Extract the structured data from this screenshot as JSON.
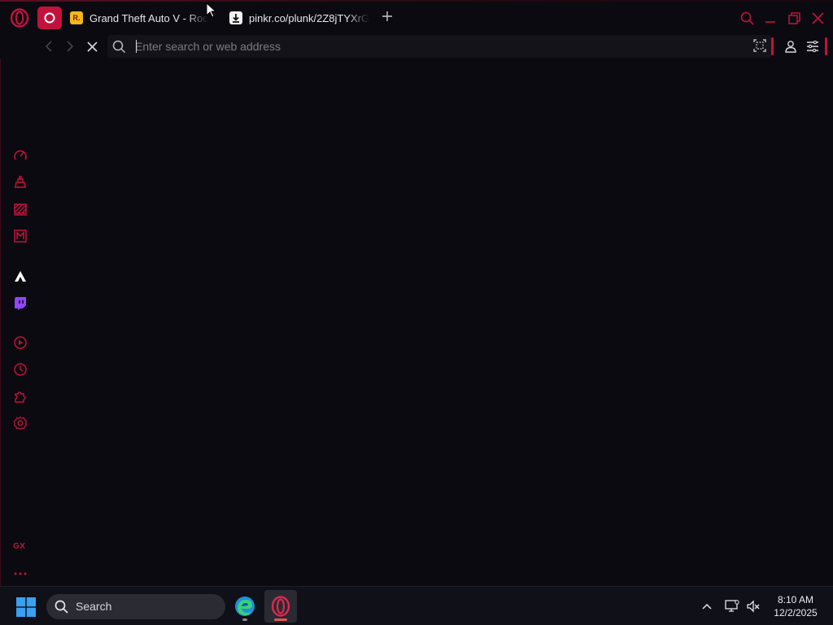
{
  "browser": {
    "name": "Opera GX",
    "accent_color": "#c1123d",
    "background_color": "#0b0a10"
  },
  "tabs": [
    {
      "title": "Grand Theft Auto V - Roc",
      "favicon": "rockstar-r-icon",
      "favicon_text": "R."
    },
    {
      "title": "pinkr.co/plunk/2Z8jTYXrG",
      "favicon": "download-icon"
    }
  ],
  "address_bar": {
    "placeholder": "Enter search or web address",
    "value": "",
    "loading": true
  },
  "sidebar": {
    "items": [
      {
        "name": "speed-dial-icon"
      },
      {
        "name": "gx-control-icon"
      },
      {
        "name": "gx-cleaner-icon"
      },
      {
        "name": "gx-corner-icon"
      },
      {
        "name": "arcade-icon"
      },
      {
        "name": "twitch-icon"
      },
      {
        "name": "player-icon"
      },
      {
        "name": "history-icon"
      },
      {
        "name": "extensions-icon"
      },
      {
        "name": "settings-icon"
      }
    ],
    "gx_label": "GX",
    "more_label": "..."
  },
  "taskbar": {
    "search_label": "Search",
    "apps": [
      {
        "name": "edge-icon"
      },
      {
        "name": "opera-gx-icon",
        "active": true
      }
    ],
    "clock": {
      "time": "8:10 AM",
      "date": "12/2/2025"
    }
  }
}
